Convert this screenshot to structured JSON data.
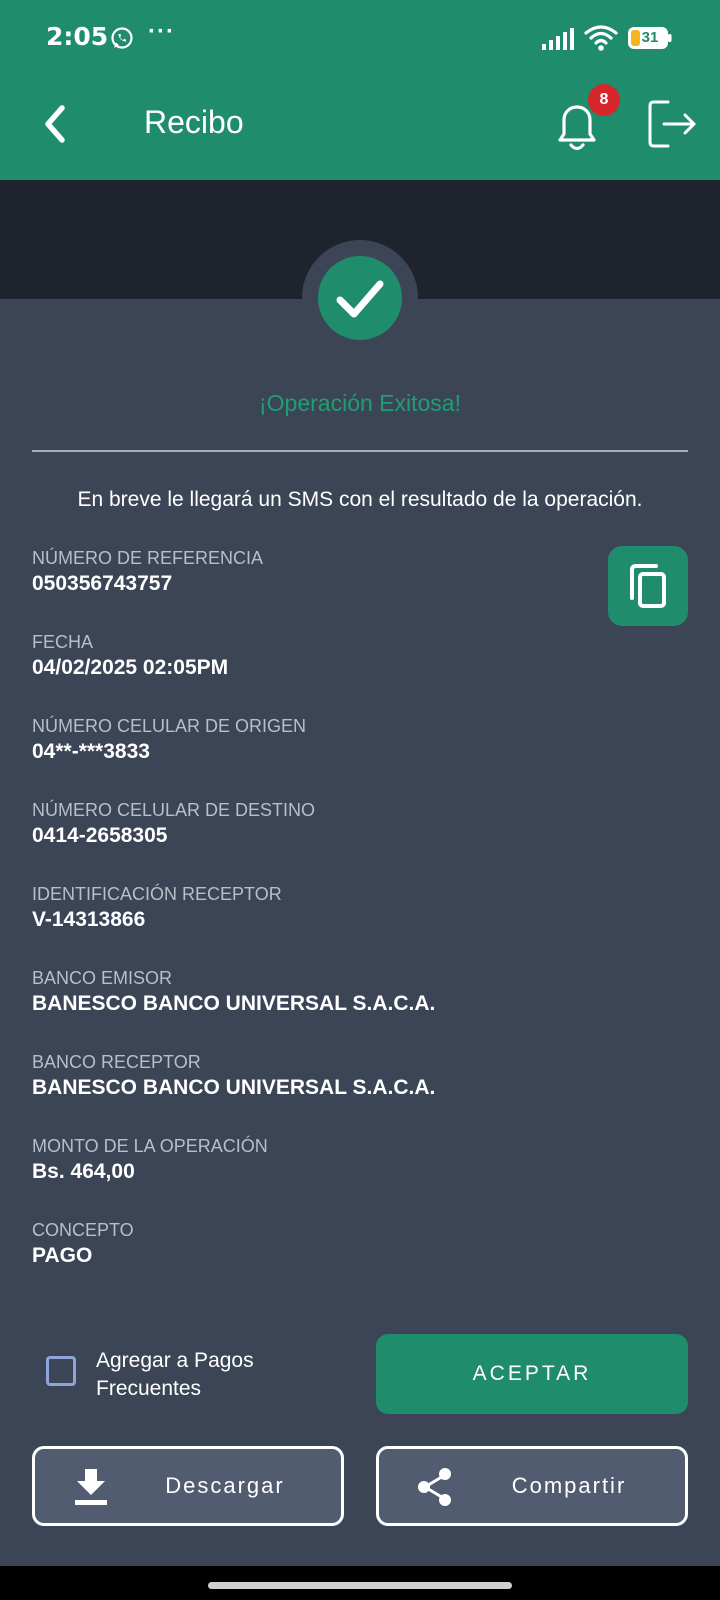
{
  "status_bar": {
    "time": "2:05",
    "more": "···",
    "battery": "31"
  },
  "header": {
    "title": "Recibo",
    "notifications_count": "8",
    "icons": [
      "back-icon",
      "bell-icon",
      "logout-icon"
    ]
  },
  "result": {
    "title": "¡Operación Exitosa!",
    "message": "En breve le llegará un SMS con el resultado de la operación."
  },
  "fields": [
    {
      "label": "NÚMERO DE REFERENCIA",
      "value": "050356743757"
    },
    {
      "label": "FECHA",
      "value": "04/02/2025 02:05PM"
    },
    {
      "label": "NÚMERO CELULAR DE ORIGEN",
      "value": "04**-***3833"
    },
    {
      "label": "NÚMERO CELULAR DE DESTINO",
      "value": "0414-2658305"
    },
    {
      "label": "IDENTIFICACIÓN RECEPTOR",
      "value": "V-14313866"
    },
    {
      "label": "BANCO EMISOR",
      "value": "BANESCO BANCO UNIVERSAL S.A.C.A."
    },
    {
      "label": "BANCO RECEPTOR",
      "value": "BANESCO BANCO UNIVERSAL S.A.C.A."
    },
    {
      "label": "MONTO DE LA OPERACIÓN",
      "value": "Bs. 464,00"
    },
    {
      "label": "CONCEPTO",
      "value": "PAGO"
    }
  ],
  "actions": {
    "add_frequent": "Agregar a Pagos Frecuentes",
    "accept": "ACEPTAR",
    "download": "Descargar",
    "share": "Compartir"
  },
  "colors": {
    "brand_green": "#1f8c6b",
    "background": "#3c4556",
    "dark_band": "#1f232d",
    "badge_red": "#d6262b"
  }
}
